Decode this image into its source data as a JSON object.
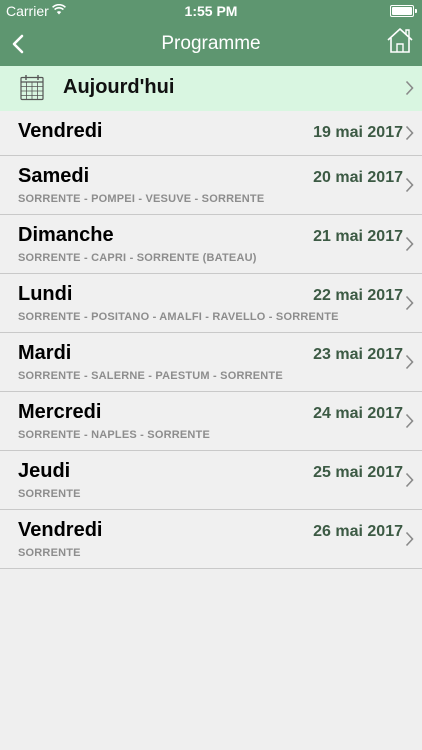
{
  "status": {
    "carrier": "Carrier",
    "time": "1:55 PM"
  },
  "nav": {
    "title": "Programme"
  },
  "today": {
    "label": "Aujourd'hui"
  },
  "days": [
    {
      "day": "Vendredi",
      "date": "19 mai 2017",
      "route": ""
    },
    {
      "day": "Samedi",
      "date": "20 mai 2017",
      "route": "SORRENTE - POMPEI - VESUVE - SORRENTE"
    },
    {
      "day": "Dimanche",
      "date": "21 mai 2017",
      "route": "SORRENTE - CAPRI - SORRENTE (BATEAU)"
    },
    {
      "day": "Lundi",
      "date": "22 mai 2017",
      "route": "SORRENTE - POSITANO - AMALFI - RAVELLO - SORRENTE"
    },
    {
      "day": "Mardi",
      "date": "23 mai 2017",
      "route": "SORRENTE - SALERNE - PAESTUM - SORRENTE"
    },
    {
      "day": "Mercredi",
      "date": "24 mai 2017",
      "route": "SORRENTE - NAPLES - SORRENTE"
    },
    {
      "day": "Jeudi",
      "date": "25 mai 2017",
      "route": "SORRENTE"
    },
    {
      "day": "Vendredi",
      "date": "26 mai 2017",
      "route": "SORRENTE"
    }
  ],
  "colors": {
    "header": "#5e9670",
    "today_bg": "#d9f6e1",
    "date_text": "#3c5a44"
  },
  "icons": {
    "back": "chevron-left-icon",
    "home": "home-icon",
    "calendar": "calendar-icon",
    "row": "chevron-right-icon"
  }
}
